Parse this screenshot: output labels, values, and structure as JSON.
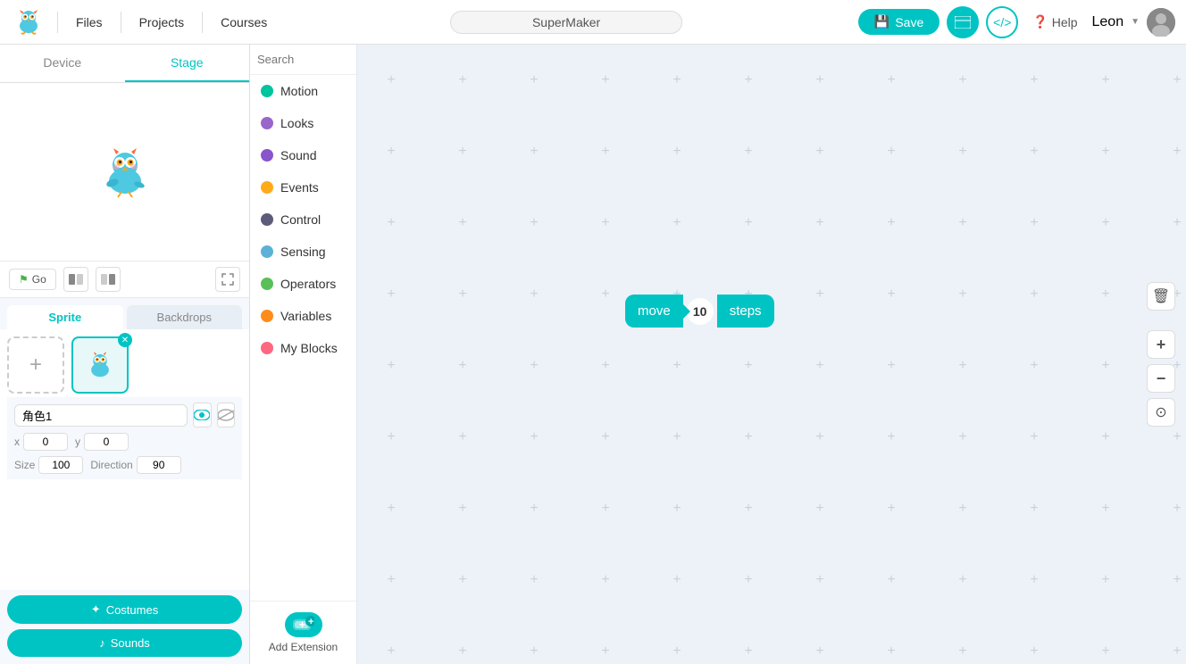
{
  "app": {
    "logo_alt": "SuperMaker Logo"
  },
  "topnav": {
    "files_label": "Files",
    "projects_label": "Projects",
    "courses_label": "Courses",
    "project_name": "SuperMaker",
    "save_label": "Save",
    "help_label": "Help",
    "user_name": "Leon",
    "user_avatar": "👤"
  },
  "left_panel": {
    "device_tab": "Device",
    "stage_tab": "Stage",
    "go_button": "Go",
    "sprite_tab": "Sprite",
    "backdrops_tab": "Backdrops",
    "sprite_name": "角色1",
    "x_label": "x",
    "x_value": "0",
    "y_label": "y",
    "y_value": "0",
    "size_label": "Size",
    "size_value": "100",
    "direction_label": "Direction",
    "direction_value": "90",
    "costumes_btn": "Costumes",
    "sounds_btn": "Sounds"
  },
  "blocks_panel": {
    "search_placeholder": "Search",
    "categories": [
      {
        "id": "motion",
        "label": "Motion",
        "color": "#00c4a0"
      },
      {
        "id": "looks",
        "label": "Looks",
        "color": "#9966cc"
      },
      {
        "id": "sound",
        "label": "Sound",
        "color": "#8855cc"
      },
      {
        "id": "events",
        "label": "Events",
        "color": "#ffab19"
      },
      {
        "id": "control",
        "label": "Control",
        "color": "#5c5c7a"
      },
      {
        "id": "sensing",
        "label": "Sensing",
        "color": "#5cb1d6"
      },
      {
        "id": "operators",
        "label": "Operators",
        "color": "#59c059"
      },
      {
        "id": "variables",
        "label": "Variables",
        "color": "#ff8c1a"
      },
      {
        "id": "my_blocks",
        "label": "My Blocks",
        "color": "#ff6680"
      }
    ],
    "add_extension_label": "Add Extension"
  },
  "code_block": {
    "move_label": "move",
    "steps_value": "10",
    "steps_label": "steps"
  },
  "canvas_tools": {
    "trash_icon": "🗑",
    "zoom_in_icon": "+",
    "zoom_out_icon": "−",
    "center_icon": "⊙"
  }
}
